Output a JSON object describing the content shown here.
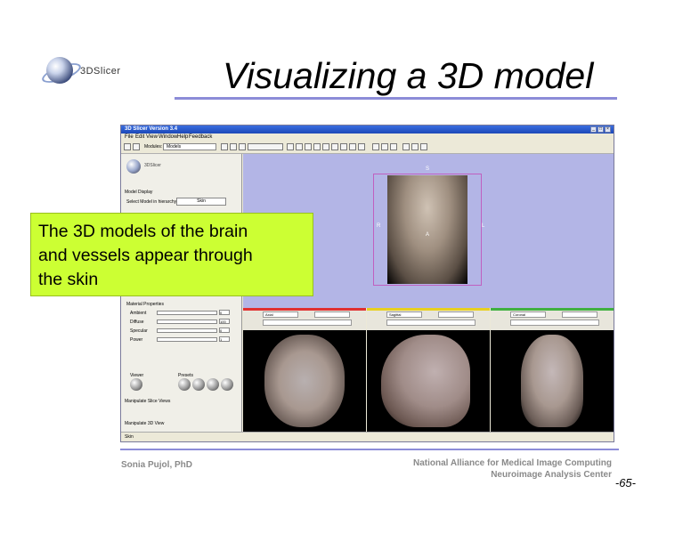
{
  "slide": {
    "title": "Visualizing a 3D model",
    "logo_text": "3DSlicer",
    "author": "Sonia Pujol, PhD",
    "org_line1": "National Alliance for Medical Image Computing",
    "org_line2": "Neuroimage Analysis Center",
    "page_number": "-65-"
  },
  "app": {
    "window_title": "3D Slicer Version 3.4",
    "menu": [
      "File",
      "Edit",
      "View",
      "Window",
      "Help",
      "Feedback"
    ],
    "modules_label": "Modules:",
    "module_selected": "Models",
    "panel_logo_text": "3DSlicer",
    "panel": {
      "model_display": "Model Display",
      "select_model_label": "Select Model in hierarchy",
      "select_model_value": "Skin",
      "material_properties": "Material Properties",
      "material_rows": [
        {
          "label": "Ambient",
          "value": "0"
        },
        {
          "label": "Diffuse",
          "value": "100"
        },
        {
          "label": "Specular",
          "value": "0"
        },
        {
          "label": "Power",
          "value": "1"
        }
      ],
      "viewer_label": "Viewer",
      "presets_label": "Presets",
      "slice_views": "Manipulate Slice Views",
      "view_3d": "Manipulate 3D View"
    },
    "view3d_orient": {
      "top": "S",
      "left": "R",
      "right": "L",
      "center": "A"
    },
    "slice_viewers": [
      {
        "name": "Axial",
        "bar_color": "#e03030"
      },
      {
        "name": "Sagittal",
        "bar_color": "#e8d020"
      },
      {
        "name": "Coronal",
        "bar_color": "#40b040"
      }
    ],
    "status": "Skin"
  },
  "callout": {
    "line1": "The 3D models of the brain",
    "line2": "and vessels appear through",
    "line3": "the skin"
  }
}
